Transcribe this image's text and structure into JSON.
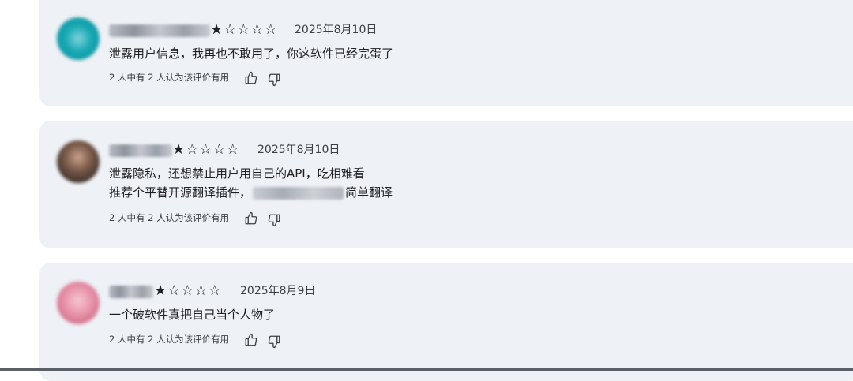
{
  "reviews": [
    {
      "rating": 1,
      "date": "2025年8月10日",
      "lines": [
        "泄露用户信息，我再也不敢用了，你这软件已经完蛋了"
      ],
      "helpful": "2 人中有 2 人认为该评价有用"
    },
    {
      "rating": 1,
      "date": "2025年8月10日",
      "lines": [
        "泄露隐私，还想禁止用户用自己的API，吃相难看"
      ],
      "line2_prefix": "推荐个平替开源翻译插件，",
      "line2_suffix": "简单翻译",
      "helpful": "2 人中有 2 人认为该评价有用"
    },
    {
      "rating": 1,
      "date": "2025年8月9日",
      "lines": [
        "一个破软件真把自己当个人物了"
      ],
      "helpful": "2 人中有 2 人认为该评价有用"
    }
  ],
  "stars": {
    "full": "★",
    "empty": "☆"
  },
  "icons": {
    "like": "thumb-up-icon",
    "dislike": "thumb-down-icon"
  }
}
